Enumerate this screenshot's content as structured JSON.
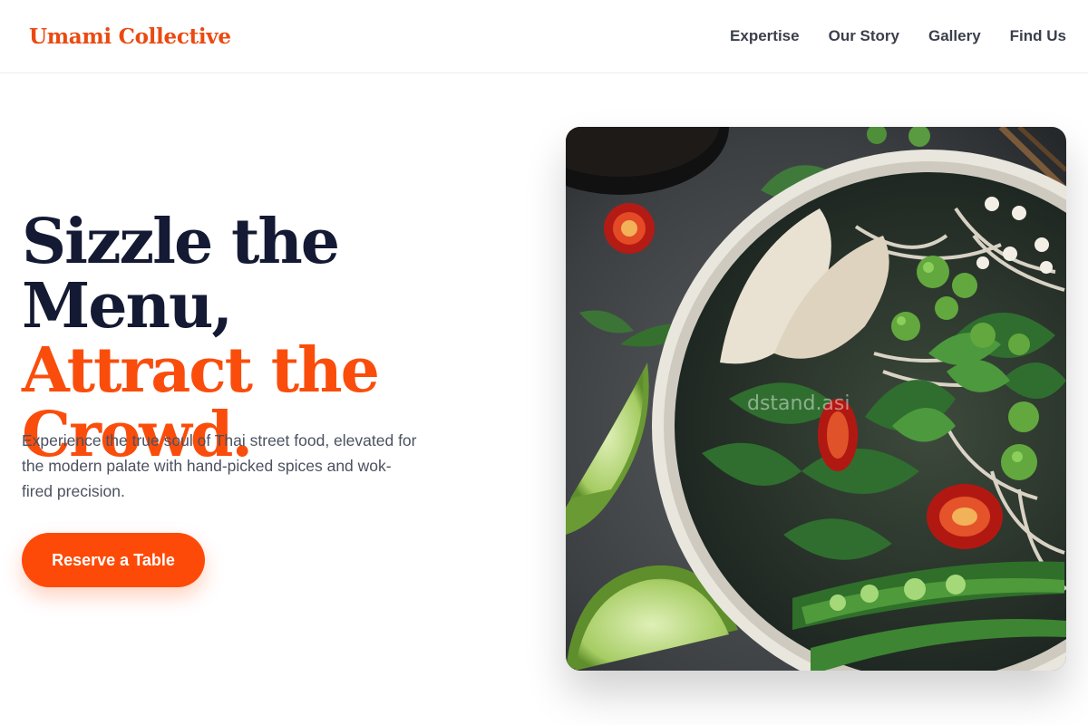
{
  "brand": {
    "name": "Umami Collective"
  },
  "nav": {
    "items": [
      {
        "label": "Expertise"
      },
      {
        "label": "Our Story"
      },
      {
        "label": "Gallery"
      },
      {
        "label": "Find Us"
      }
    ]
  },
  "hero": {
    "title_line1": "Sizzle the Menu,",
    "title_accent_line1": "Attract the",
    "title_accent_line2": "Crowd.",
    "description": "Experience the true soul of Thai street food, elevated for the modern palate with hand-picked spices and wok-fired precision.",
    "cta_label": "Reserve a Table"
  },
  "image": {
    "watermark": "dstand.asi",
    "alt": "Bowl of Thai noodle soup with herbs, chili, peas and lime"
  },
  "colors": {
    "accent": "#fa4d0c",
    "title_dark": "#141a33",
    "text_muted": "#4b5160"
  }
}
